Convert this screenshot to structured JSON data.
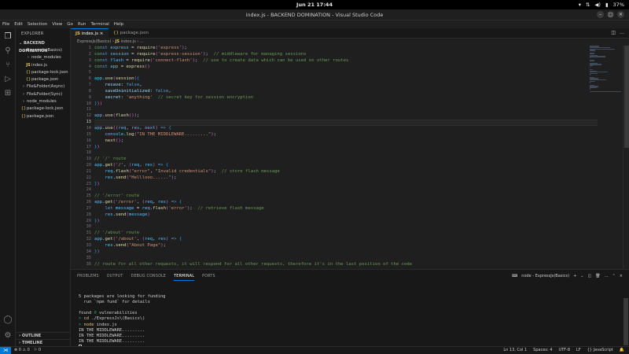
{
  "system": {
    "clock": "Jun 21  17:44",
    "battery": "37%"
  },
  "window": {
    "title": "index.js - BACKEND DOMINATION - Visual Studio Code"
  },
  "menu": [
    "File",
    "Edit",
    "Selection",
    "View",
    "Go",
    "Run",
    "Terminal",
    "Help"
  ],
  "sidebar": {
    "header": "EXPLORER",
    "section": "BACKEND DOMINATION",
    "tree": [
      {
        "label": "ExpressJs(Basics)",
        "type": "folder-open",
        "depth": 1
      },
      {
        "label": "node_modules",
        "type": "folder",
        "depth": 2
      },
      {
        "label": "index.js",
        "type": "js",
        "depth": 2
      },
      {
        "label": "package-lock.json",
        "type": "json",
        "depth": 2
      },
      {
        "label": "package.json",
        "type": "json",
        "depth": 2
      },
      {
        "label": "File&Folder(Async)",
        "type": "folder",
        "depth": 1
      },
      {
        "label": "File&Folder(Sync)",
        "type": "folder",
        "depth": 1
      },
      {
        "label": "node_modules",
        "type": "folder",
        "depth": 1
      },
      {
        "label": "package-lock.json",
        "type": "json",
        "depth": 1
      },
      {
        "label": "package.json",
        "type": "json",
        "depth": 1
      }
    ],
    "outline": "OUTLINE",
    "timeline": "TIMELINE"
  },
  "tabs": [
    {
      "label": "index.js",
      "icon": "JS",
      "active": true
    },
    {
      "label": "package.json",
      "icon": "{}",
      "active": false
    }
  ],
  "breadcrumb": [
    "ExpressJs(Basics)",
    "index.js",
    "..."
  ],
  "editor": {
    "current_line": 13,
    "lines": [
      "const express = require('express');",
      "const session = require('express-session');  // middleware for managing sessions",
      "const flash = require('connect-flash');  // use to create data which can be used on other routes",
      "const app = express()",
      "",
      "app.use(session({",
      "    resave: false,",
      "    saveUninitialized: false,",
      "    secret: 'anything'  // secret key for session encryption",
      "}))",
      "",
      "app.use(flash());",
      "",
      "app.use((req, res, next) => {",
      "    console.log(\"IN THE MIDDLEWARE.........\");",
      "    next();",
      "})",
      "",
      "// '/' route",
      "app.get('/', (req, res) => {",
      "    req.flash(\"error\", \"Invalid credentials\");  // store flash message",
      "    res.send(\"Helllooo......\");",
      "})",
      "",
      "// '/error' route",
      "app.get('/error', (req, res) => {",
      "    let message = req.flash('error');  // retrieve flash message",
      "    res.send(message)",
      "})",
      "",
      "// '/about' route",
      "app.get('/about', (req, res) => {",
      "    res.send(\"About Page\");",
      "})",
      "",
      "// route for all other requests, it will respond for all other requests, therefore it's in the last position of the code"
    ]
  },
  "panel": {
    "tabs": [
      "PROBLEMS",
      "OUTPUT",
      "DEBUG CONSOLE",
      "TERMINAL",
      "PORTS"
    ],
    "active_tab": "TERMINAL",
    "terminal_name": "node - ExpressJs(Basics)",
    "terminal": [
      "",
      "5 packages are looking for funding",
      "  run `npm fund` for details",
      "",
      "found 0 vulnerabilities",
      "> cd ./ExpressJs\\(Basics\\)",
      "> node index.js",
      "IN THE MIDDLEWARE.........",
      "IN THE MIDDLEWARE.........",
      "IN THE MIDDLEWARE........."
    ]
  },
  "status": {
    "errors": "0",
    "warnings": "0",
    "ports": "0",
    "position": "Ln 13, Col 1",
    "spaces": "Spaces: 4",
    "encoding": "UTF-8",
    "eol": "LF",
    "language": "JavaScript"
  },
  "colors": {
    "accent": "#0078d4",
    "editor_bg": "#1f1f1f",
    "sidebar_bg": "#181818",
    "js_icon": "#e3c45a"
  }
}
